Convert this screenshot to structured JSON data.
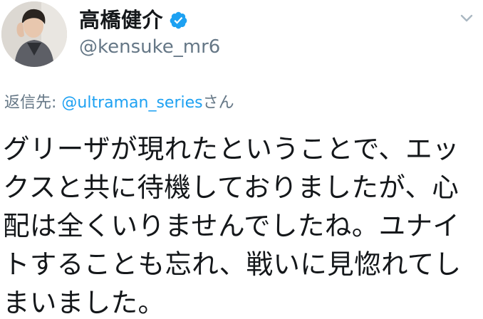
{
  "tweet": {
    "author": {
      "display_name": "高橋健介",
      "username": "@kensuke_mr6",
      "verified": true,
      "verified_color": "#1da1f2"
    },
    "reply": {
      "prefix": "返信先: ",
      "handle": "@ultraman_series",
      "suffix": "さん"
    },
    "body": "グリーザが現れたということで、エックスと共に待機しておりましたが、心配は全くいりませんでしたね。ユナイトすることも忘れ、戦いに見惚れてしまいました。",
    "icons": {
      "verified": "verified-badge-icon",
      "menu": "chevron-down-icon",
      "avatar": "profile-photo"
    },
    "colors": {
      "text": "#14171a",
      "secondary": "#657786",
      "link": "#1da1f2",
      "background": "#ffffff"
    }
  }
}
